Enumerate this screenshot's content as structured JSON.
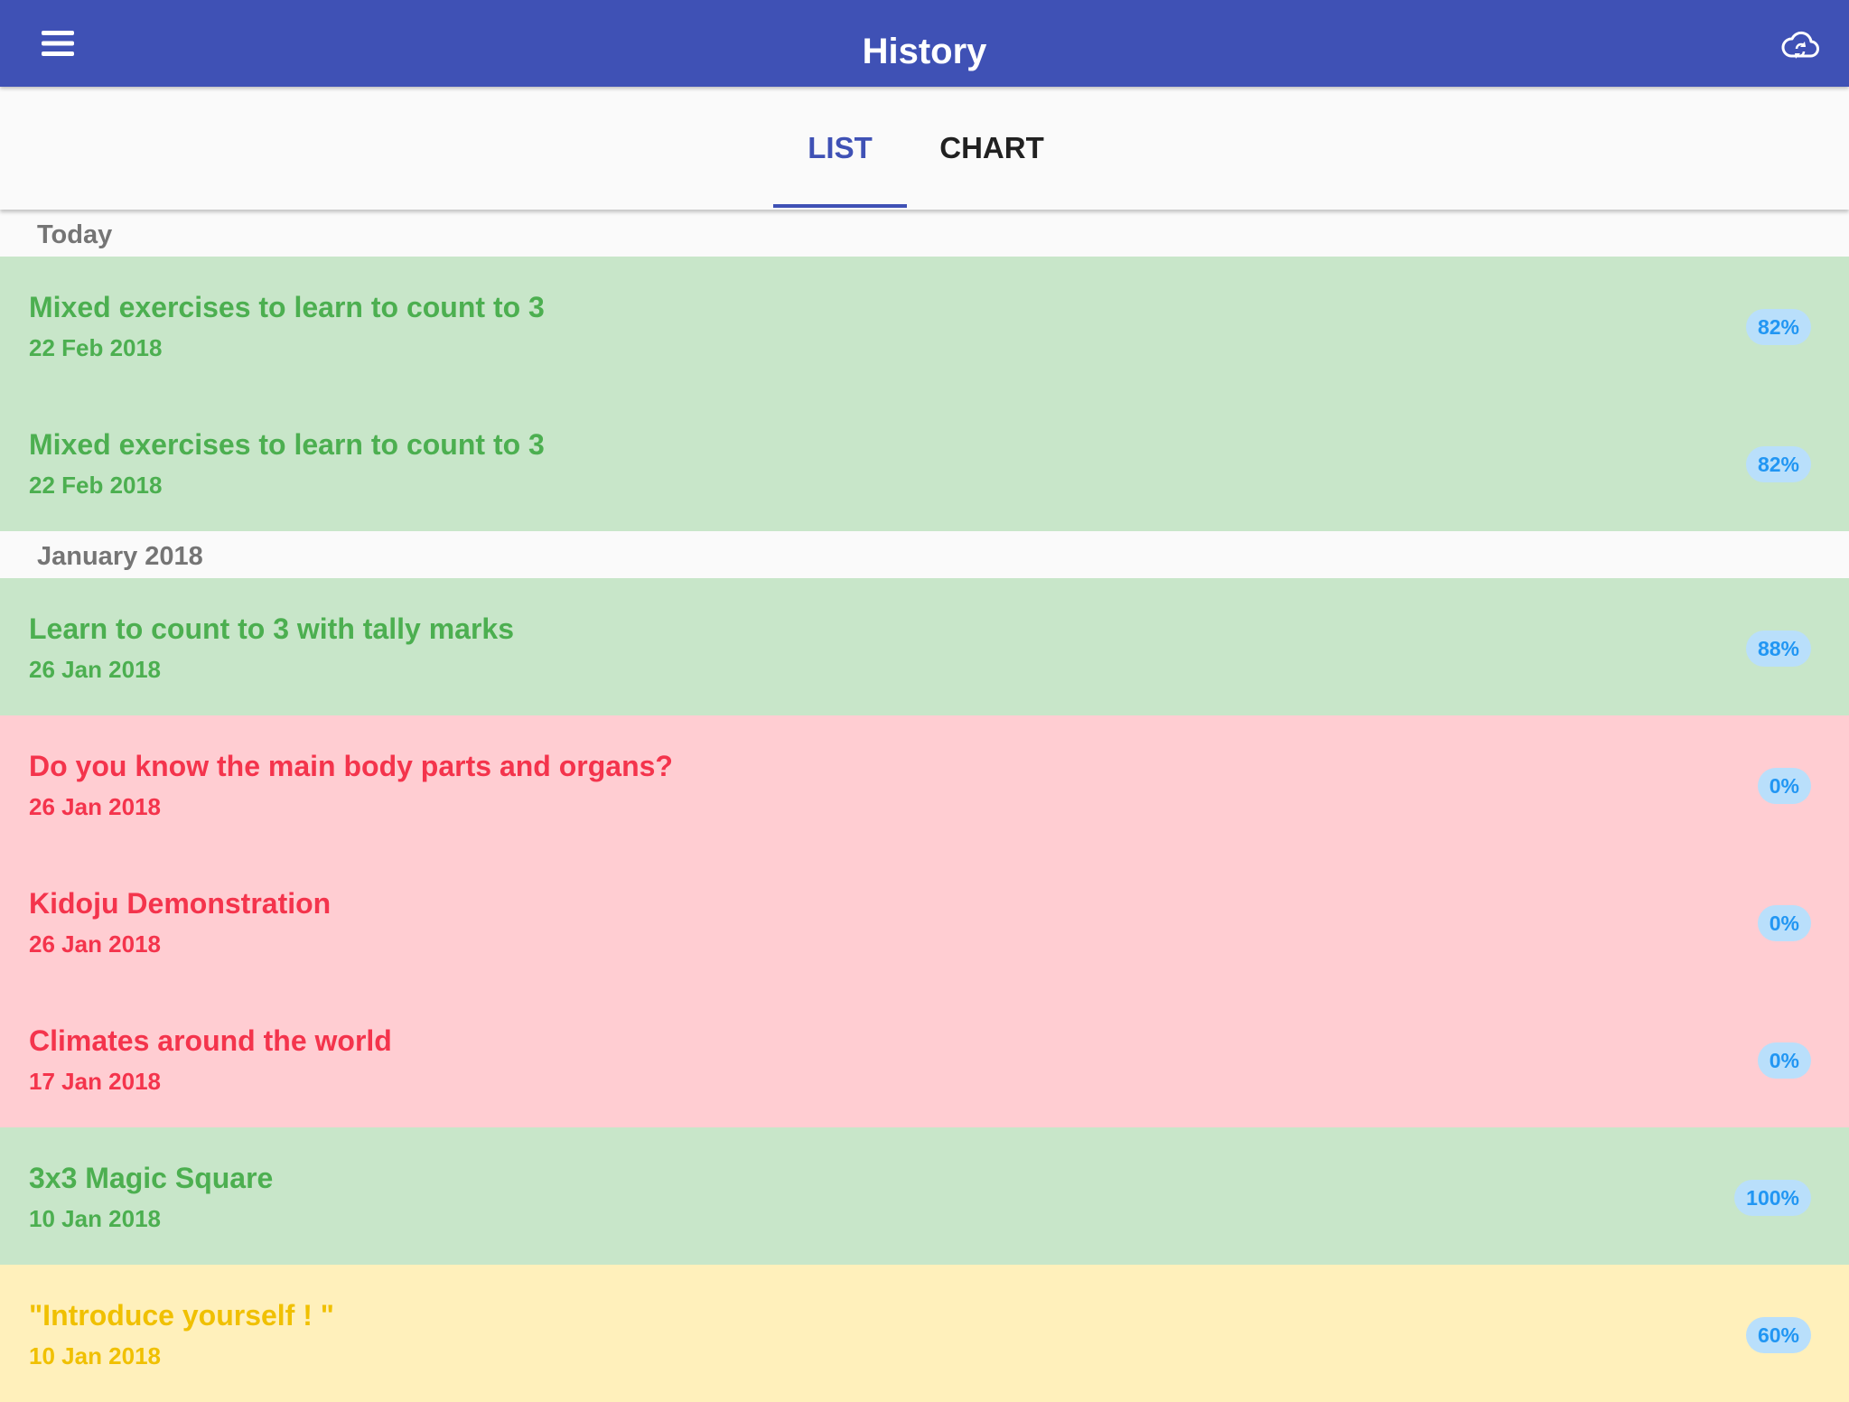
{
  "app": {
    "title": "History"
  },
  "icons": {
    "menu": "menu-icon",
    "sync": "cloud-sync-icon"
  },
  "colors": {
    "primary": "#3f51b5",
    "pass_bg": "#c8e6c9",
    "pass_text": "#4caf50",
    "fail_bg": "#ffcdd2",
    "fail_text": "#f4344c",
    "mid_bg": "#fff0bb",
    "mid_text": "#f0c000",
    "badge_bg": "#b9dffb",
    "badge_text": "#2196f3"
  },
  "tabs": [
    {
      "label": "LIST",
      "selected": true
    },
    {
      "label": "CHART",
      "selected": false
    }
  ],
  "sections": [
    {
      "label": "Today",
      "items": [
        {
          "title": "Mixed exercises to learn to count to 3",
          "date": "22 Feb 2018",
          "score": "82%",
          "status": "pass"
        },
        {
          "title": "Mixed exercises to learn to count to 3",
          "date": "22 Feb 2018",
          "score": "82%",
          "status": "pass"
        }
      ]
    },
    {
      "label": "January 2018",
      "items": [
        {
          "title": "Learn to count to 3 with tally marks",
          "date": "26 Jan 2018",
          "score": "88%",
          "status": "pass"
        },
        {
          "title": "Do you know the main body parts and organs?",
          "date": "26 Jan 2018",
          "score": "0%",
          "status": "fail"
        },
        {
          "title": "Kidoju Demonstration",
          "date": "26 Jan 2018",
          "score": "0%",
          "status": "fail"
        },
        {
          "title": "Climates around the world",
          "date": "17 Jan 2018",
          "score": "0%",
          "status": "fail"
        },
        {
          "title": "3x3 Magic Square",
          "date": "10 Jan 2018",
          "score": "100%",
          "status": "pass"
        },
        {
          "title": "\"Introduce yourself ! \"",
          "date": "10 Jan 2018",
          "score": "60%",
          "status": "mid"
        }
      ]
    }
  ]
}
